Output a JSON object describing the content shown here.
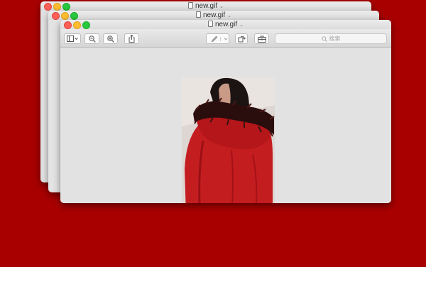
{
  "windows": [
    {
      "title": "new.gif"
    },
    {
      "title": "new.gif"
    },
    {
      "title": "new.gif"
    }
  ],
  "toolbar": {
    "search_placeholder": "搜索"
  },
  "icons": {
    "sidebar": "sidebar-toggle-icon",
    "zoom_out": "zoom-out-icon",
    "zoom_in": "zoom-in-icon",
    "share": "share-icon",
    "markup": "pen-icon",
    "rotate": "rotate-icon",
    "toolbox": "toolbox-icon",
    "search": "search-icon"
  },
  "colors": {
    "desktop": "#a80000",
    "coat": "#c41d20",
    "fur": "#2a0d0d"
  }
}
